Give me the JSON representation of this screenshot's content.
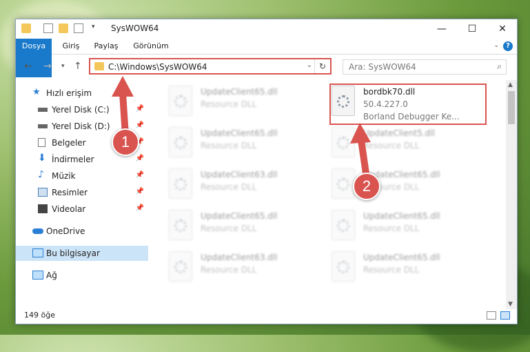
{
  "window": {
    "title": "SysWOW64"
  },
  "ribbon": {
    "tabs": [
      "Dosya",
      "Giriş",
      "Paylaş",
      "Görünüm"
    ]
  },
  "address": {
    "path": "C:\\Windows\\SysWOW64"
  },
  "search": {
    "placeholder": "Ara: SysWOW64"
  },
  "sidebar": {
    "items": [
      {
        "label": "Hızlı erişim"
      },
      {
        "label": "Yerel Disk (C:)"
      },
      {
        "label": "Yerel Disk (D:)"
      },
      {
        "label": "Belgeler"
      },
      {
        "label": "İndirmeler"
      },
      {
        "label": "Müzik"
      },
      {
        "label": "Resimler"
      },
      {
        "label": "Videolar"
      },
      {
        "label": "OneDrive"
      },
      {
        "label": "Bu bilgisayar"
      },
      {
        "label": "Ağ"
      }
    ]
  },
  "files": [
    {
      "name": "UpdateClient65.dll",
      "desc": "Resource DLL"
    },
    {
      "name": "bordbk70.dll",
      "desc": "50.4.227.0",
      "desc2": "Borland Debugger Ke..."
    },
    {
      "name": "UpdateClient65.dll",
      "desc": "Resource DLL"
    },
    {
      "name": "UpdateClient5.dll",
      "desc": "Resource DLL"
    },
    {
      "name": "UpdateClient63.dll",
      "desc": "Resource DLL"
    },
    {
      "name": "UpdateClient65.dll",
      "desc": "Resource DLL"
    },
    {
      "name": "UpdateClient65.dll",
      "desc": "Resource DLL"
    },
    {
      "name": "UpdateClient65.dll",
      "desc": "Resource DLL"
    },
    {
      "name": "UpdateClient63.dll",
      "desc": "Resource DLL"
    },
    {
      "name": "UpdateClient65.dll",
      "desc": "Resource DLL"
    }
  ],
  "status": {
    "count": "149 öğe"
  },
  "callouts": [
    "1",
    "2"
  ],
  "colors": {
    "accent": "#1979ca",
    "highlight": "#d9534f",
    "selected": "#cce4f7"
  }
}
